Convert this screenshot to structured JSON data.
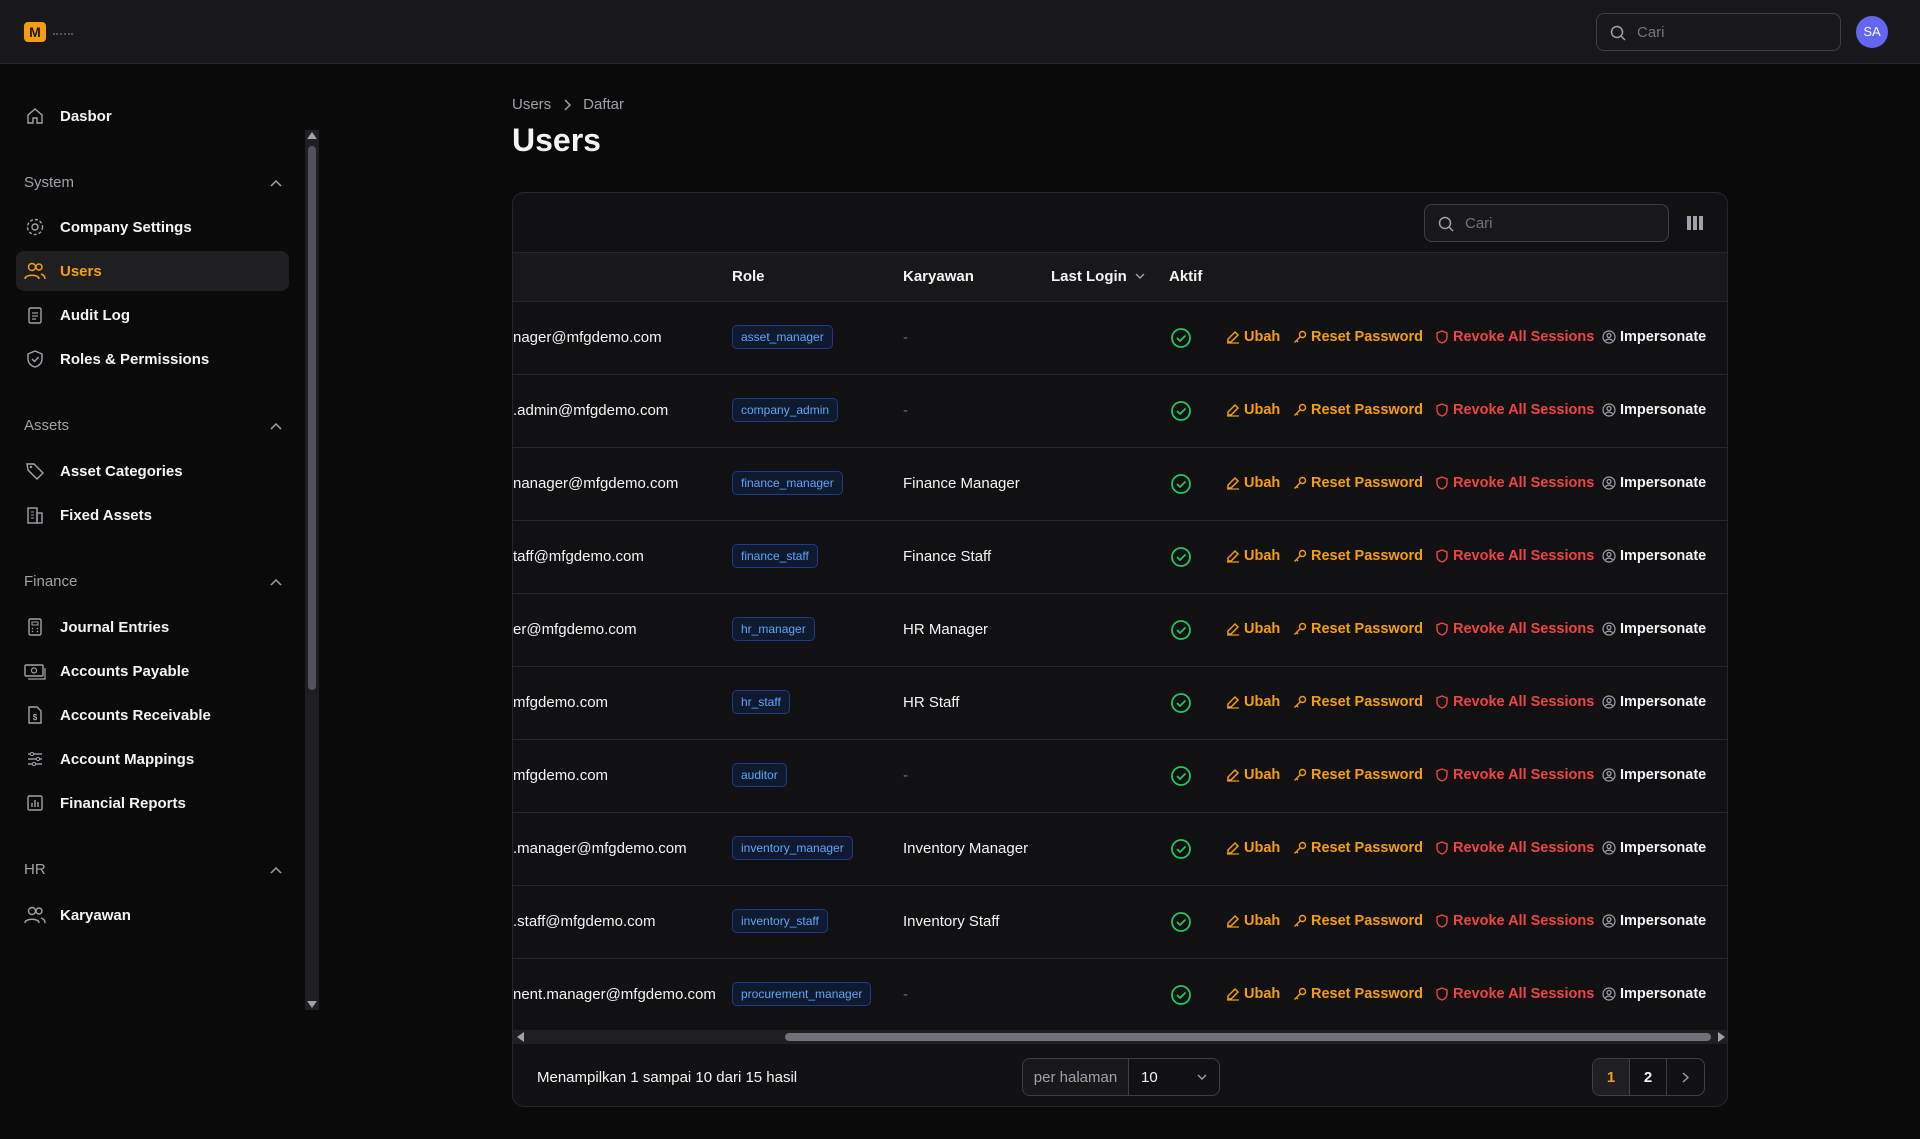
{
  "app": {
    "logo_letter": "M"
  },
  "topbar": {
    "search_placeholder": "Cari",
    "avatar_initials": "SA"
  },
  "sidebar": {
    "dashboard": "Dasbor",
    "groups": [
      {
        "label": "System",
        "items": [
          "Company Settings",
          "Users",
          "Audit Log",
          "Roles & Permissions"
        ]
      },
      {
        "label": "Assets",
        "items": [
          "Asset Categories",
          "Fixed Assets"
        ]
      },
      {
        "label": "Finance",
        "items": [
          "Journal Entries",
          "Accounts Payable",
          "Accounts Receivable",
          "Account Mappings",
          "Financial Reports"
        ]
      },
      {
        "label": "HR",
        "items": [
          "Karyawan"
        ]
      }
    ],
    "active_item": "Users"
  },
  "breadcrumb": {
    "parent": "Users",
    "current": "Daftar"
  },
  "page_title": "Users",
  "table": {
    "search_placeholder": "Cari",
    "columns": {
      "role": "Role",
      "employee": "Karyawan",
      "last_login": "Last Login",
      "active": "Aktif"
    },
    "actions": {
      "edit": "Ubah",
      "reset": "Reset Password",
      "revoke": "Revoke All Sessions",
      "impersonate": "Impersonate"
    },
    "rows": [
      {
        "email": "nager@mfgdemo.com",
        "role": "asset_manager",
        "employee": "-"
      },
      {
        "email": ".admin@mfgdemo.com",
        "role": "company_admin",
        "employee": "-"
      },
      {
        "email": "nanager@mfgdemo.com",
        "role": "finance_manager",
        "employee": "Finance Manager"
      },
      {
        "email": "taff@mfgdemo.com",
        "role": "finance_staff",
        "employee": "Finance Staff"
      },
      {
        "email": "er@mfgdemo.com",
        "role": "hr_manager",
        "employee": "HR Manager"
      },
      {
        "email": "mfgdemo.com",
        "role": "hr_staff",
        "employee": "HR Staff"
      },
      {
        "email": "mfgdemo.com",
        "role": "auditor",
        "employee": "-"
      },
      {
        "email": ".manager@mfgdemo.com",
        "role": "inventory_manager",
        "employee": "Inventory Manager"
      },
      {
        "email": ".staff@mfgdemo.com",
        "role": "inventory_staff",
        "employee": "Inventory Staff"
      },
      {
        "email": "nent.manager@mfgdemo.com",
        "role": "procurement_manager",
        "employee": "-"
      }
    ]
  },
  "footer": {
    "info": "Menampilkan 1 sampai 10 dari 15 hasil",
    "per_page_label": "per halaman",
    "per_page_value": "10",
    "pages": [
      "1",
      "2"
    ],
    "current_page": "1"
  },
  "colors": {
    "accent": "#f59e0b",
    "danger": "#ef4444",
    "success": "#22c55e",
    "badge": "#60a5fa"
  }
}
